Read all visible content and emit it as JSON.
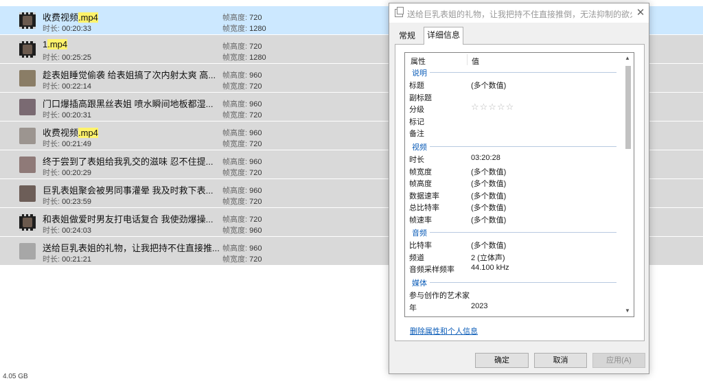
{
  "labels": {
    "duration": "时长:",
    "frame_height": "帧高度:",
    "frame_width": "帧宽度:"
  },
  "files": [
    {
      "name_pre": "收费视频",
      "name_hl": ".mp4",
      "duration": "00:20:33",
      "height": "720",
      "width": "1280",
      "thumb": "video",
      "selected": true
    },
    {
      "name_pre": "1",
      "name_hl": ".mp4",
      "duration": "00:25:25",
      "height": "720",
      "width": "1280",
      "thumb": "video",
      "selected": false
    },
    {
      "name_pre": "趁表姐睡觉偷袭 给表姐搞了次内射太爽 高...",
      "name_hl": "",
      "duration": "00:22:14",
      "height": "960",
      "width": "720",
      "thumb": "photo",
      "color": "#8a7d66",
      "selected": false
    },
    {
      "name_pre": "门口爆插高跟黑丝表姐 喷水瞬间地板都湿...",
      "name_hl": "",
      "duration": "00:20:31",
      "height": "960",
      "width": "720",
      "thumb": "photo",
      "color": "#7a6a72",
      "selected": false
    },
    {
      "name_pre": "收费视频",
      "name_hl": ".mp4",
      "duration": "00:21:49",
      "height": "960",
      "width": "720",
      "thumb": "photo",
      "color": "#9c9590",
      "selected": false
    },
    {
      "name_pre": "终于尝到了表姐给我乳交的滋味 忍不住提...",
      "name_hl": "",
      "duration": "00:20:29",
      "height": "960",
      "width": "720",
      "thumb": "photo",
      "color": "#8f7a78",
      "selected": false
    },
    {
      "name_pre": "巨乳表姐聚会被男同事灌晕 我及时救下表...",
      "name_hl": "",
      "duration": "00:23:59",
      "height": "960",
      "width": "720",
      "thumb": "photo",
      "color": "#6d5e58",
      "selected": false
    },
    {
      "name_pre": "和表姐做爱时男友打电话复合 我使劲爆操...",
      "name_hl": "",
      "duration": "00:24:03",
      "height": "720",
      "width": "960",
      "thumb": "video",
      "selected": false
    },
    {
      "name_pre": "送给巨乳表姐的礼物，让我把持不住直接推...",
      "name_hl": "",
      "duration": "00:21:21",
      "height": "960",
      "width": "720",
      "thumb": "photo",
      "color": "#a7a7a7",
      "selected": false
    }
  ],
  "status": {
    "size": "4.05 GB"
  },
  "dialog": {
    "title": "送给巨乳表姐的礼物，让我把持不住直接推倒，无法抑制的欲火！！...",
    "close_glyph": "✕",
    "tabs": [
      "常规",
      "详细信息"
    ],
    "active_tab": "详细信息",
    "columns": {
      "property": "属性",
      "value": "值"
    },
    "groups": {
      "description": "说明",
      "video": "视频",
      "audio": "音频",
      "media": "媒体"
    },
    "props": {
      "title_k": "标题",
      "title_v": "(多个数值)",
      "subtitle_k": "副标题",
      "rating_k": "分级",
      "rating_stars": "☆☆☆☆☆",
      "tags_k": "标记",
      "comments_k": "备注",
      "length_k": "时长",
      "length_v": "03:20:28",
      "fwidth_k": "帧宽度",
      "fwidth_v": "(多个数值)",
      "fheight_k": "帧高度",
      "fheight_v": "(多个数值)",
      "datarate_k": "数据速率",
      "datarate_v": "(多个数值)",
      "bitrate_k": "总比特率",
      "bitrate_v": "(多个数值)",
      "framerate_k": "帧速率",
      "framerate_v": "(多个数值)",
      "abitrate_k": "比特率",
      "abitrate_v": "(多个数值)",
      "channels_k": "频道",
      "channels_v": "2 (立体声)",
      "samplerate_k": "音频采样频率",
      "samplerate_v": "44.100 kHz",
      "artists_k": "参与创作的艺术家",
      "year_k": "年",
      "year_v": "2023"
    },
    "remove_link": "删除属性和个人信息",
    "buttons": {
      "ok": "确定",
      "cancel": "取消",
      "apply": "应用(A)"
    }
  }
}
